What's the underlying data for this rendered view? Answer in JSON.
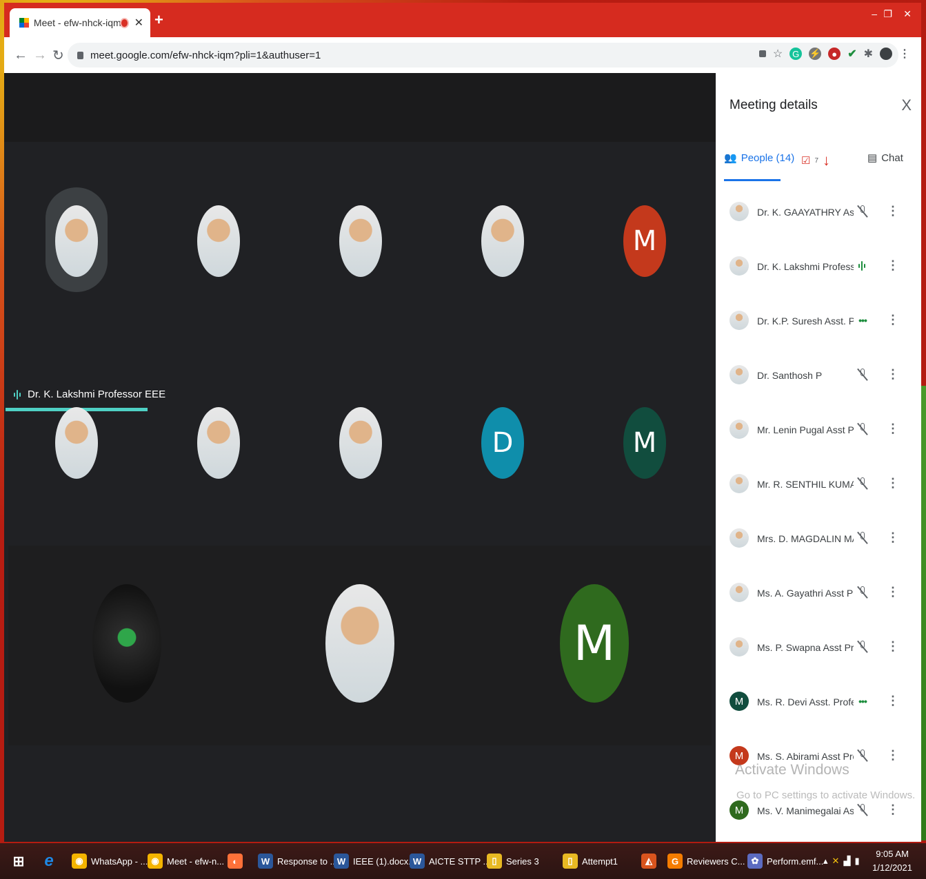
{
  "browser": {
    "tab_title": "Meet - efw-nhck-iqm",
    "url": "meet.google.com/efw-nhck-iqm?pli=1&authuser=1"
  },
  "meet": {
    "active_speaker": "Dr. K. Lakshmi Professor EEE",
    "tiles": [
      {
        "initial": "",
        "color": ""
      },
      {
        "initial": "",
        "color": ""
      },
      {
        "initial": "",
        "color": ""
      },
      {
        "initial": "",
        "color": ""
      },
      {
        "initial": "M",
        "color": "#c4391c"
      },
      {
        "initial": "",
        "color": ""
      },
      {
        "initial": "",
        "color": ""
      },
      {
        "initial": "",
        "color": ""
      },
      {
        "initial": "D",
        "color": "#0f8eab"
      },
      {
        "initial": "M",
        "color": "#114d3e"
      },
      {
        "initial": "",
        "color": ""
      },
      {
        "initial": "",
        "color": ""
      },
      {
        "initial": "M",
        "color": "#2f6a1e"
      }
    ]
  },
  "panel": {
    "title": "Meeting details",
    "close": "X",
    "tab_people": "People (14)",
    "tab_tasks_count": "7",
    "tab_chat": "Chat",
    "people": [
      {
        "name": "Dr. K. GAAYATHRY Asst ...",
        "status": "muted",
        "avatar": "photo"
      },
      {
        "name": "Dr. K. Lakshmi Professo...",
        "status": "speaking",
        "avatar": "photo"
      },
      {
        "name": "Dr. K.P. Suresh Asst. Pro...",
        "status": "dots",
        "avatar": "photo"
      },
      {
        "name": "Dr. Santhosh P",
        "status": "muted",
        "avatar": "photo"
      },
      {
        "name": "Mr. Lenin Pugal Asst Pro...",
        "status": "muted",
        "avatar": "photo"
      },
      {
        "name": "Mr. R. SENTHIL KUMAR ...",
        "status": "muted",
        "avatar": "photo"
      },
      {
        "name": "Mrs. D. MAGDALIN MA...",
        "status": "muted",
        "avatar": "photo"
      },
      {
        "name": "Ms. A. Gayathri Asst Pro...",
        "status": "muted",
        "avatar": "photo"
      },
      {
        "name": "Ms. P. Swapna Asst Prof...",
        "status": "muted",
        "avatar": "photo"
      },
      {
        "name": "Ms. R. Devi Asst. Profes...",
        "status": "dots",
        "avatar": "M",
        "color": "#114d3e"
      },
      {
        "name": "Ms. S. Abirami Asst Prof...",
        "status": "muted",
        "avatar": "M",
        "color": "#c4391c"
      },
      {
        "name": "Ms. V. Manimegalai Asst...",
        "status": "muted",
        "avatar": "M",
        "color": "#2f6a1e"
      }
    ]
  },
  "watermark": {
    "line1": "Activate Windows",
    "line2": "Go to PC settings to activate Windows."
  },
  "taskbar": {
    "items": [
      "WhatsApp - ...",
      "Meet - efw-n...",
      "Response to ...",
      "IEEE (1).docx...",
      "AICTE STTP ...",
      "Series 3",
      "Attempt1",
      "Reviewers C...",
      "Perform.emf..."
    ],
    "time": "9:05 AM",
    "date": "1/12/2021"
  }
}
